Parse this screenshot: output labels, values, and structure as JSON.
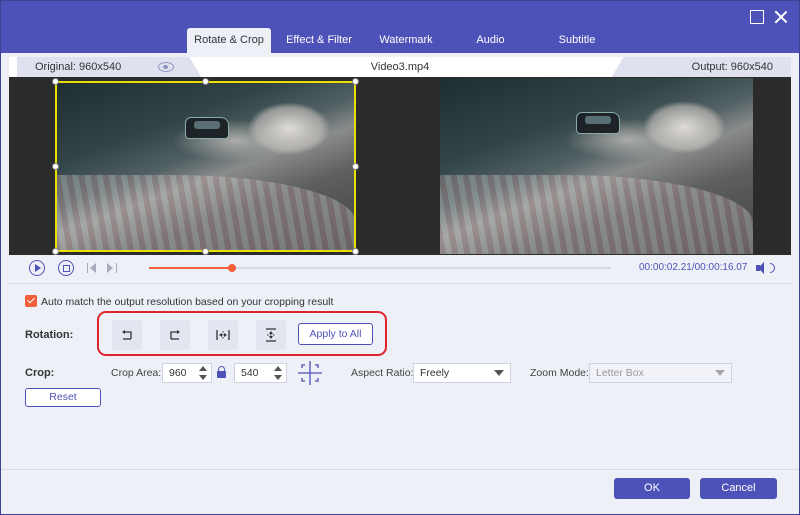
{
  "tabs": [
    {
      "label": "Rotate & Crop",
      "active": true
    },
    {
      "label": "Effect & Filter",
      "active": false
    },
    {
      "label": "Watermark",
      "active": false
    },
    {
      "label": "Audio",
      "active": false
    },
    {
      "label": "Subtitle",
      "active": false
    }
  ],
  "preview": {
    "original_label": "Original: 960x540",
    "filename": "Video3.mp4",
    "output_label": "Output: 960x540"
  },
  "player": {
    "time": "00:00:02.21/00:00:16.07",
    "progress_fraction": 0.18
  },
  "options": {
    "auto_match_label": "Auto match the output resolution based on your cropping result",
    "auto_match_checked": true,
    "rotation_label": "Rotation:",
    "apply_to_all": "Apply to All",
    "crop_label": "Crop:",
    "crop_area_label": "Crop Area:",
    "crop_width": "960",
    "crop_height": "540",
    "aspect_ratio_label": "Aspect Ratio:",
    "aspect_ratio_value": "Freely",
    "zoom_mode_label": "Zoom Mode:",
    "zoom_mode_value": "Letter Box",
    "reset": "Reset"
  },
  "footer": {
    "ok": "OK",
    "cancel": "Cancel"
  },
  "colors": {
    "accent": "#4d52b8",
    "progress": "#f25d3a",
    "crop_frame": "#e8e000",
    "highlight": "#e0242c"
  },
  "icons": [
    "maximize-icon",
    "close-icon",
    "eye-icon",
    "play-icon",
    "stop-icon",
    "previous-frame-icon",
    "next-frame-icon",
    "volume-icon",
    "rotate-left-icon",
    "rotate-right-icon",
    "flip-horizontal-icon",
    "flip-vertical-icon",
    "lock-icon",
    "center-crop-icon"
  ]
}
